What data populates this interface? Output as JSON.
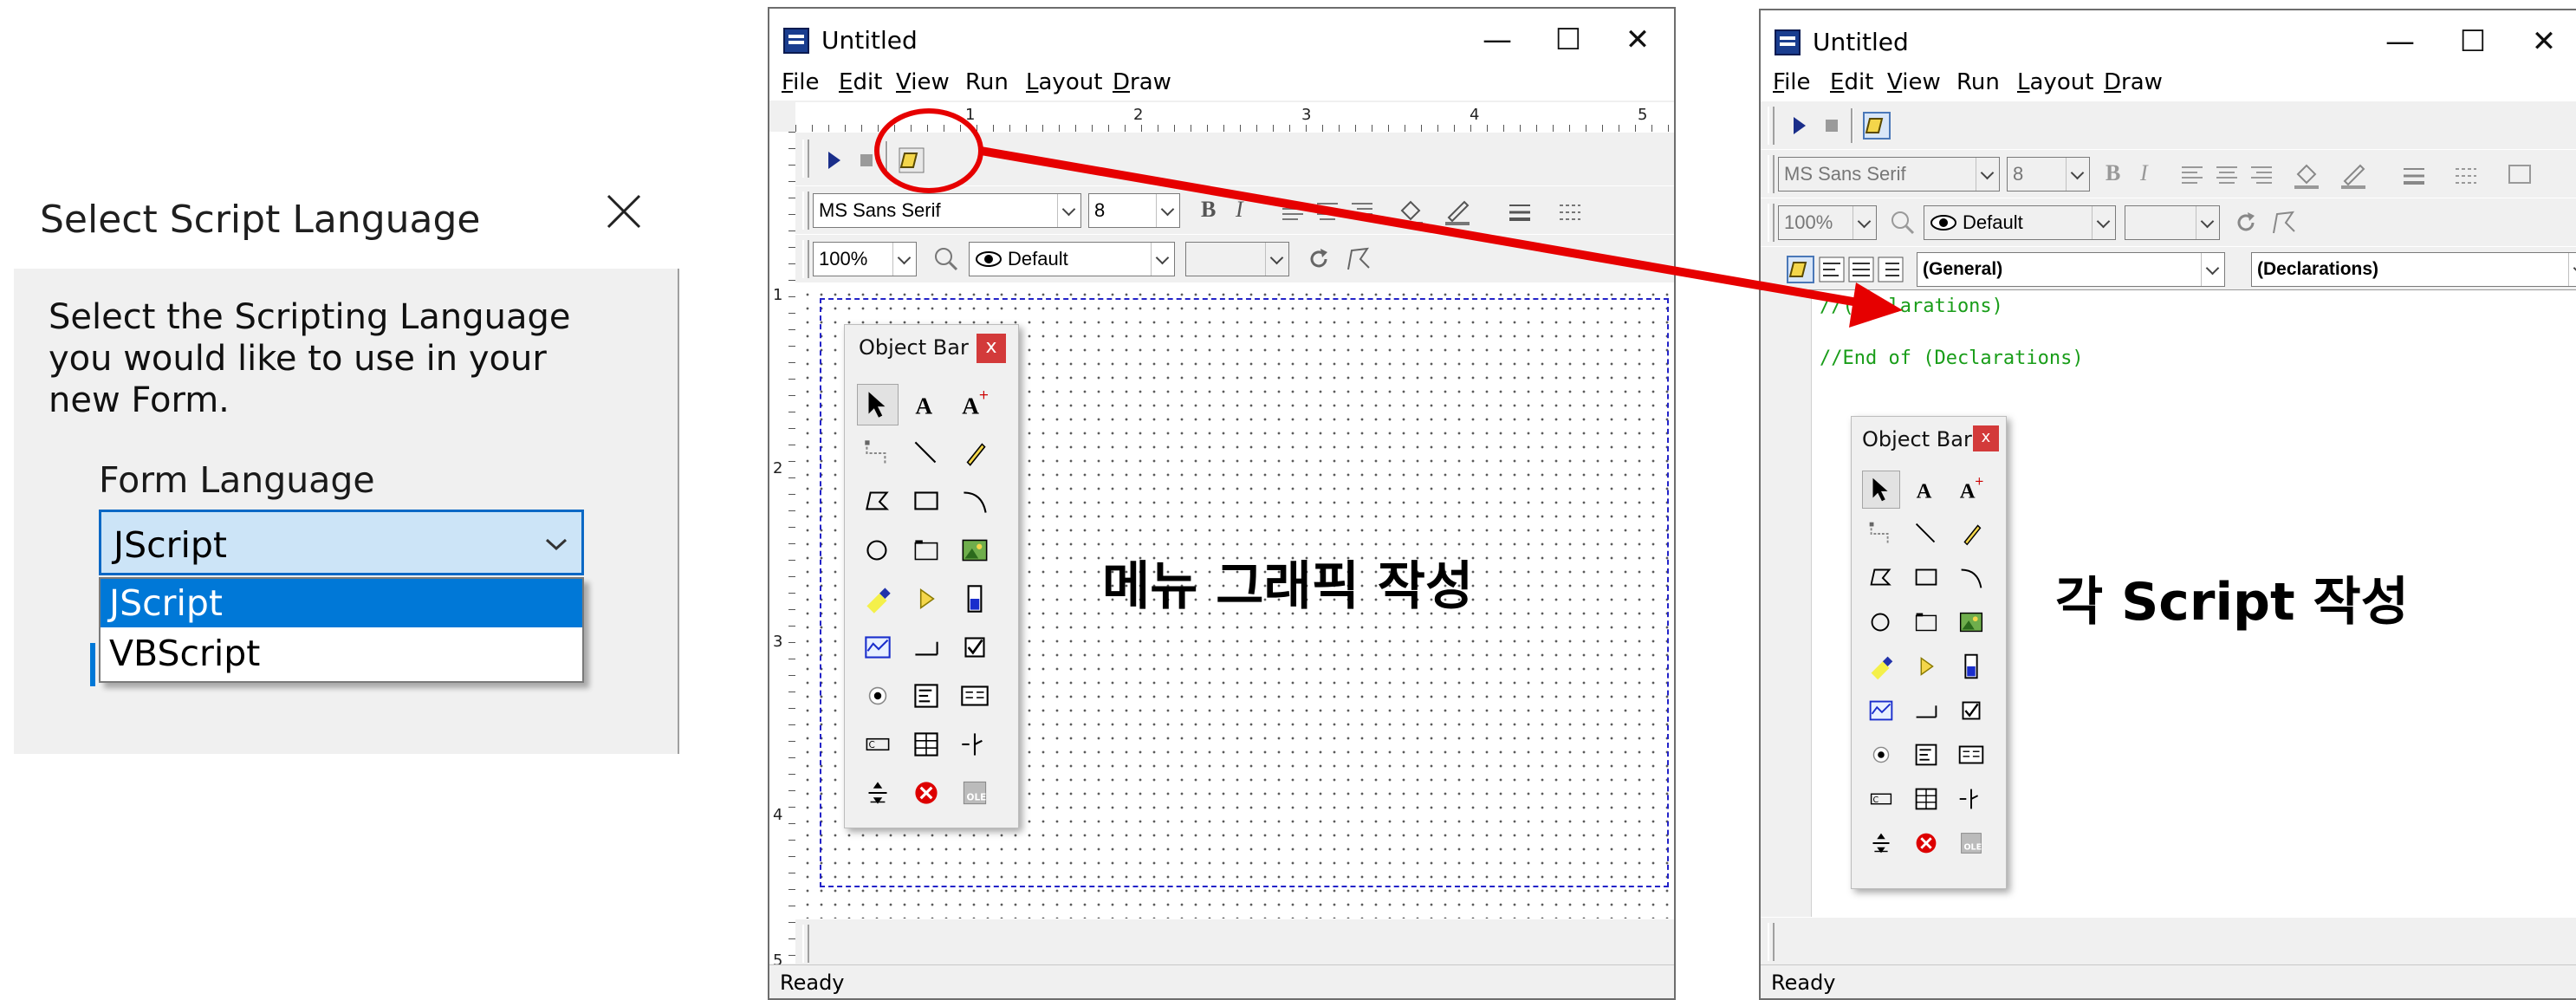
{
  "dialog": {
    "title": "Select Script Language",
    "prompt": "Select the Scripting Language you would like to use in your new Form.",
    "field_label": "Form Language",
    "selected_value": "JScript",
    "options": [
      "JScript",
      "VBScript"
    ]
  },
  "window_left": {
    "title": "Untitled",
    "controls": {
      "minimize": "—",
      "maximize": "☐",
      "close": "✕"
    },
    "menu": [
      {
        "hot": "F",
        "rest": "ile"
      },
      {
        "hot": "E",
        "rest": "dit"
      },
      {
        "hot": "V",
        "rest": "iew"
      },
      {
        "hot": "",
        "rest": "Run"
      },
      {
        "hot": "L",
        "rest": "ayout"
      },
      {
        "hot": "D",
        "rest": "raw"
      }
    ],
    "font_name": "MS Sans Serif",
    "font_size": "8",
    "zoom": "100%",
    "layer": "Default",
    "bold": "B",
    "italic": "I",
    "ruler_numbers": [
      "1",
      "2",
      "3",
      "4",
      "5"
    ],
    "vruler_numbers": [
      "1",
      "2",
      "3",
      "4",
      "5"
    ],
    "object_bar_title": "Object Bar",
    "object_bar_close": "x",
    "annotation": "메뉴 그래픽 작성",
    "status": "Ready"
  },
  "window_right": {
    "title": "Untitled",
    "controls": {
      "minimize": "—",
      "maximize": "☐",
      "close": "✕"
    },
    "menu": [
      {
        "hot": "F",
        "rest": "ile"
      },
      {
        "hot": "E",
        "rest": "dit"
      },
      {
        "hot": "V",
        "rest": "iew"
      },
      {
        "hot": "",
        "rest": "Run"
      },
      {
        "hot": "L",
        "rest": "ayout"
      },
      {
        "hot": "D",
        "rest": "raw"
      }
    ],
    "font_name": "MS Sans Serif",
    "font_size": "8",
    "zoom": "100%",
    "layer": "Default",
    "bold": "B",
    "italic": "I",
    "object_combo": "(General)",
    "proc_combo": "(Declarations)",
    "code_lines": [
      "//(Declarations)",
      "",
      "//End of (Declarations)"
    ],
    "object_bar_title": "Object Bar",
    "object_bar_close": "x",
    "annotation": "각 Script 작성",
    "status": "Ready"
  },
  "colors": {
    "selection_blue": "#0078d7",
    "arrow_red": "#e60000",
    "code_green": "#199d19",
    "grid_blue": "#2323c8"
  }
}
